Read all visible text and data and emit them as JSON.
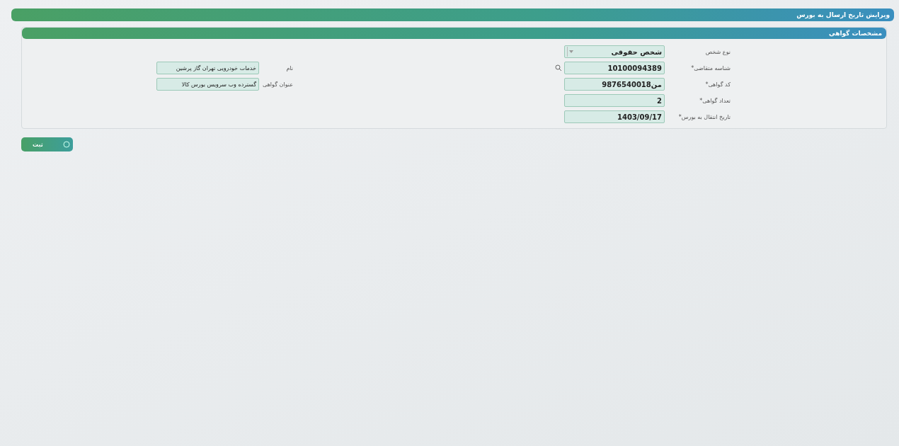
{
  "window": {
    "title": "ویرایش تاریخ ارسال به بورس"
  },
  "panel": {
    "title": "مشخصات گواهی",
    "right_fields": [
      {
        "kind": "select",
        "label": "نوع شخص",
        "value": "شخص حقوقی"
      },
      {
        "kind": "search",
        "label": "شناسه متقاضی*",
        "value": "10100094389"
      },
      {
        "kind": "text",
        "label": "کد گواهی*",
        "value": "من9876540018"
      },
      {
        "kind": "text",
        "label": "تعداد گواهی*",
        "value": "2"
      },
      {
        "kind": "text",
        "label": "تاریخ انتقال به بورس*",
        "value": "1403/09/17"
      }
    ],
    "left_fields": [
      {
        "label": "نام",
        "value": "خدمات خودرویی تهران گاز پرشین"
      },
      {
        "label": "عنوان گواهی",
        "value": "گسترده وب سرویس بورس کالا"
      }
    ]
  },
  "buttons": [
    {
      "label": "ثبت"
    }
  ]
}
